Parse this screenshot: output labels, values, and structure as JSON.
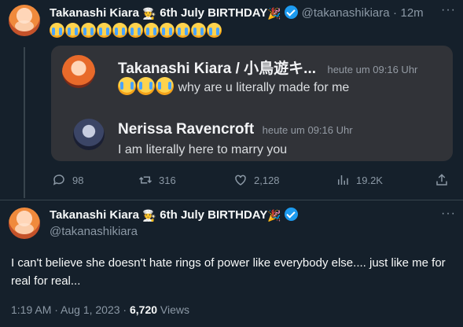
{
  "reply_tweet": {
    "display_name": "Takanashi Kiara",
    "name_suffix": "6th July BIRTHDAY",
    "handle": "@takanashikiara",
    "time": "12m",
    "emoji_count": 11
  },
  "discord_embed": {
    "messages": [
      {
        "author": "Takanashi Kiara / 小鳥遊キ...",
        "timestamp": "heute um 09:16 Uhr",
        "text": "why are u literally made for me",
        "emoji_count": 3
      },
      {
        "author": "Nerissa Ravencroft",
        "timestamp": "heute um 09:16 Uhr",
        "text": "I am literally here to marry you"
      }
    ]
  },
  "actions": {
    "replies": "98",
    "retweets": "316",
    "likes": "2,128",
    "views": "19.2K"
  },
  "main_tweet": {
    "display_name": "Takanashi Kiara",
    "name_suffix": "6th July BIRTHDAY",
    "handle": "@takanashikiara",
    "text": "I can't believe she doesn't hate  rings of power like everybody else.... just like me for real for real...",
    "timestamp": "1:19 AM · Aug 1, 2023 · ",
    "views_count": "6,720",
    "views_label": " Views"
  },
  "colors": {
    "background": "#15202b",
    "verified": "#1d9bf0",
    "embed_background": "#313338",
    "secondary_text": "#8b98a5"
  },
  "icons": [
    "verified-badge-icon",
    "party-popper-icon",
    "chef-hat-icon",
    "more-icon",
    "reply-icon",
    "retweet-icon",
    "like-icon",
    "views-icon",
    "share-icon"
  ]
}
